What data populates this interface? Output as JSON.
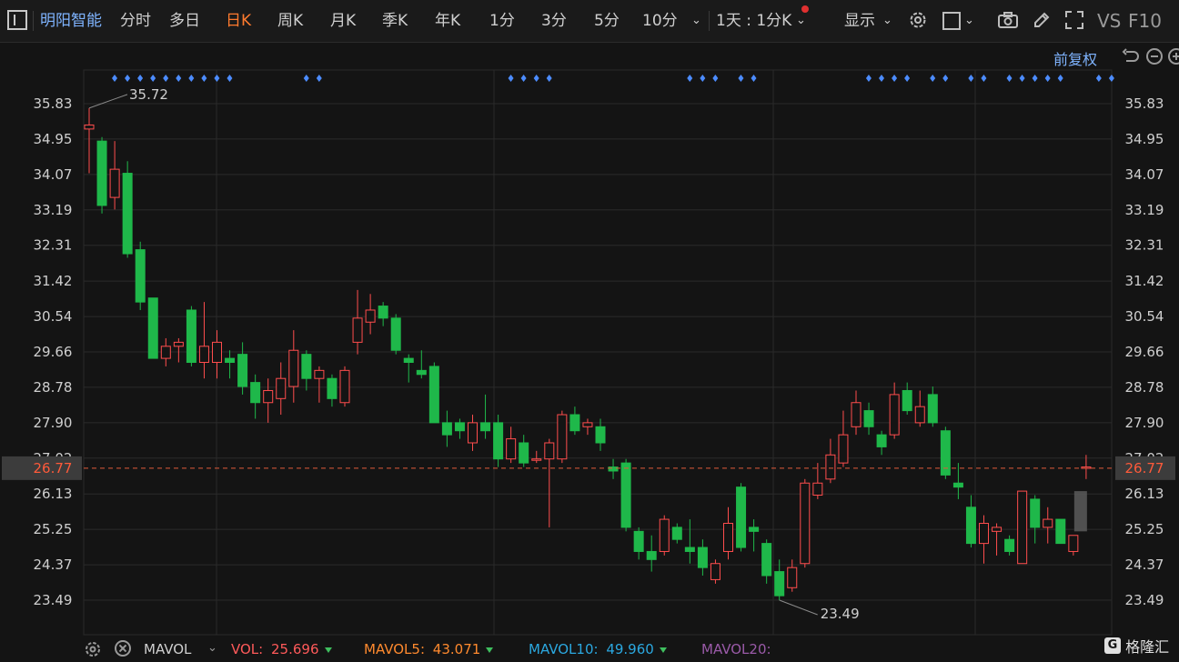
{
  "toolbar": {
    "stock_name": "明阳智能",
    "periods": [
      "分时",
      "多日",
      "日K",
      "周K",
      "月K",
      "季K",
      "年K",
      "1分",
      "3分",
      "5分",
      "10分"
    ],
    "selected_period": "日K",
    "multi_view": "1天 : 1分K",
    "display_label": "显示",
    "vs_label": "VS",
    "f10_label": "F10"
  },
  "adjust_label": "前复权",
  "colors": {
    "up": "#ff4d4d",
    "down": "#1fb84a",
    "grid": "#2a2a2a",
    "accent": "#ff7a2e",
    "blue": "#4c8cff"
  },
  "price_axis_labels": [
    "35.83",
    "34.95",
    "34.07",
    "33.19",
    "32.31",
    "31.42",
    "30.54",
    "29.66",
    "28.78",
    "27.90",
    "27.02",
    "26.13",
    "25.25",
    "24.37",
    "23.49"
  ],
  "current_price": "26.77",
  "max_annotation": "35.72",
  "min_annotation": "23.49",
  "chart_data": {
    "type": "candlestick",
    "ylim": [
      23.49,
      35.83
    ],
    "candles": [
      {
        "o": 35.2,
        "h": 35.72,
        "l": 34.1,
        "c": 35.3
      },
      {
        "o": 34.9,
        "h": 35.0,
        "l": 33.1,
        "c": 33.3
      },
      {
        "o": 33.5,
        "h": 34.9,
        "l": 33.2,
        "c": 34.2
      },
      {
        "o": 34.1,
        "h": 34.4,
        "l": 32.0,
        "c": 32.1
      },
      {
        "o": 32.2,
        "h": 32.4,
        "l": 30.7,
        "c": 30.9
      },
      {
        "o": 31.0,
        "h": 31.0,
        "l": 29.5,
        "c": 29.5
      },
      {
        "o": 29.5,
        "h": 30.0,
        "l": 29.3,
        "c": 29.8
      },
      {
        "o": 29.8,
        "h": 30.0,
        "l": 29.4,
        "c": 29.9
      },
      {
        "o": 30.7,
        "h": 30.8,
        "l": 29.3,
        "c": 29.4
      },
      {
        "o": 29.4,
        "h": 30.9,
        "l": 29.0,
        "c": 29.8
      },
      {
        "o": 29.4,
        "h": 30.2,
        "l": 29.0,
        "c": 29.9
      },
      {
        "o": 29.5,
        "h": 29.7,
        "l": 29.0,
        "c": 29.4
      },
      {
        "o": 29.6,
        "h": 29.9,
        "l": 28.6,
        "c": 28.8
      },
      {
        "o": 28.9,
        "h": 29.1,
        "l": 28.0,
        "c": 28.4
      },
      {
        "o": 28.4,
        "h": 29.0,
        "l": 27.9,
        "c": 28.7
      },
      {
        "o": 28.5,
        "h": 29.4,
        "l": 28.1,
        "c": 29.0
      },
      {
        "o": 28.8,
        "h": 30.2,
        "l": 28.4,
        "c": 29.7
      },
      {
        "o": 29.6,
        "h": 29.7,
        "l": 28.7,
        "c": 29.0
      },
      {
        "o": 29.0,
        "h": 29.3,
        "l": 28.4,
        "c": 29.2
      },
      {
        "o": 29.0,
        "h": 29.1,
        "l": 28.3,
        "c": 28.5
      },
      {
        "o": 28.4,
        "h": 29.3,
        "l": 28.3,
        "c": 29.2
      },
      {
        "o": 29.9,
        "h": 31.2,
        "l": 29.6,
        "c": 30.5
      },
      {
        "o": 30.4,
        "h": 31.1,
        "l": 30.1,
        "c": 30.7
      },
      {
        "o": 30.8,
        "h": 30.9,
        "l": 30.3,
        "c": 30.5
      },
      {
        "o": 30.5,
        "h": 30.6,
        "l": 29.6,
        "c": 29.7
      },
      {
        "o": 29.5,
        "h": 29.6,
        "l": 28.9,
        "c": 29.4
      },
      {
        "o": 29.2,
        "h": 29.7,
        "l": 29.0,
        "c": 29.1
      },
      {
        "o": 29.3,
        "h": 29.4,
        "l": 27.9,
        "c": 27.9
      },
      {
        "o": 27.9,
        "h": 28.2,
        "l": 27.3,
        "c": 27.6
      },
      {
        "o": 27.9,
        "h": 28.0,
        "l": 27.5,
        "c": 27.7
      },
      {
        "o": 27.4,
        "h": 28.1,
        "l": 27.2,
        "c": 27.9
      },
      {
        "o": 27.9,
        "h": 28.6,
        "l": 27.5,
        "c": 27.7
      },
      {
        "o": 27.9,
        "h": 28.1,
        "l": 26.8,
        "c": 27.0
      },
      {
        "o": 27.0,
        "h": 27.8,
        "l": 26.9,
        "c": 27.5
      },
      {
        "o": 27.4,
        "h": 27.6,
        "l": 26.8,
        "c": 26.9
      },
      {
        "o": 27.0,
        "h": 27.2,
        "l": 26.9,
        "c": 27.0
      },
      {
        "o": 27.0,
        "h": 27.5,
        "l": 25.3,
        "c": 27.4
      },
      {
        "o": 27.0,
        "h": 28.2,
        "l": 26.9,
        "c": 28.1
      },
      {
        "o": 28.1,
        "h": 28.3,
        "l": 27.6,
        "c": 27.7
      },
      {
        "o": 27.8,
        "h": 28.0,
        "l": 27.6,
        "c": 27.9
      },
      {
        "o": 27.8,
        "h": 28.0,
        "l": 27.2,
        "c": 27.4
      },
      {
        "o": 26.8,
        "h": 27.0,
        "l": 26.5,
        "c": 26.7
      },
      {
        "o": 26.9,
        "h": 27.0,
        "l": 25.2,
        "c": 25.3
      },
      {
        "o": 25.2,
        "h": 25.3,
        "l": 24.5,
        "c": 24.7
      },
      {
        "o": 24.7,
        "h": 25.1,
        "l": 24.2,
        "c": 24.5
      },
      {
        "o": 24.7,
        "h": 25.6,
        "l": 24.6,
        "c": 25.5
      },
      {
        "o": 25.3,
        "h": 25.4,
        "l": 24.9,
        "c": 25.0
      },
      {
        "o": 24.8,
        "h": 25.5,
        "l": 24.4,
        "c": 24.7
      },
      {
        "o": 24.8,
        "h": 25.0,
        "l": 24.1,
        "c": 24.3
      },
      {
        "o": 24.0,
        "h": 24.5,
        "l": 23.9,
        "c": 24.4
      },
      {
        "o": 24.7,
        "h": 25.8,
        "l": 24.5,
        "c": 25.4
      },
      {
        "o": 26.3,
        "h": 26.4,
        "l": 24.7,
        "c": 24.8
      },
      {
        "o": 25.3,
        "h": 25.5,
        "l": 24.7,
        "c": 25.2
      },
      {
        "o": 24.9,
        "h": 25.0,
        "l": 23.9,
        "c": 24.1
      },
      {
        "o": 24.2,
        "h": 24.5,
        "l": 23.49,
        "c": 23.6
      },
      {
        "o": 23.8,
        "h": 24.5,
        "l": 23.7,
        "c": 24.3
      },
      {
        "o": 24.4,
        "h": 26.5,
        "l": 24.3,
        "c": 26.4
      },
      {
        "o": 26.1,
        "h": 26.9,
        "l": 26.0,
        "c": 26.4
      },
      {
        "o": 26.5,
        "h": 27.5,
        "l": 26.4,
        "c": 27.1
      },
      {
        "o": 26.9,
        "h": 28.2,
        "l": 26.8,
        "c": 27.6
      },
      {
        "o": 27.8,
        "h": 28.7,
        "l": 27.6,
        "c": 28.4
      },
      {
        "o": 28.2,
        "h": 28.4,
        "l": 27.6,
        "c": 27.8
      },
      {
        "o": 27.6,
        "h": 27.7,
        "l": 27.1,
        "c": 27.3
      },
      {
        "o": 27.6,
        "h": 28.9,
        "l": 27.5,
        "c": 28.6
      },
      {
        "o": 28.7,
        "h": 28.9,
        "l": 28.1,
        "c": 28.2
      },
      {
        "o": 27.9,
        "h": 28.7,
        "l": 27.8,
        "c": 28.3
      },
      {
        "o": 28.6,
        "h": 28.8,
        "l": 27.8,
        "c": 27.9
      },
      {
        "o": 27.7,
        "h": 27.8,
        "l": 26.5,
        "c": 26.6
      },
      {
        "o": 26.4,
        "h": 26.9,
        "l": 26.0,
        "c": 26.3
      },
      {
        "o": 25.8,
        "h": 26.1,
        "l": 24.8,
        "c": 24.9
      },
      {
        "o": 24.9,
        "h": 25.6,
        "l": 24.4,
        "c": 25.4
      },
      {
        "o": 25.2,
        "h": 25.4,
        "l": 24.6,
        "c": 25.3
      },
      {
        "o": 25.0,
        "h": 25.1,
        "l": 24.6,
        "c": 24.7
      },
      {
        "o": 24.4,
        "h": 26.2,
        "l": 24.4,
        "c": 26.2
      },
      {
        "o": 26.0,
        "h": 26.1,
        "l": 24.9,
        "c": 25.3
      },
      {
        "o": 25.3,
        "h": 25.8,
        "l": 24.9,
        "c": 25.5
      },
      {
        "o": 25.5,
        "h": 25.5,
        "l": 24.9,
        "c": 24.9
      },
      {
        "o": 24.7,
        "h": 25.0,
        "l": 24.6,
        "c": 25.1
      },
      {
        "o": 26.8,
        "h": 27.1,
        "l": 26.5,
        "c": 26.8
      }
    ],
    "marker_groups": [
      [
        0,
        9
      ],
      [
        15,
        16
      ],
      [
        31,
        34
      ],
      [
        45,
        47
      ],
      [
        49,
        50
      ],
      [
        59,
        62
      ],
      [
        64,
        65
      ],
      [
        67,
        68
      ],
      [
        70,
        74
      ],
      [
        77,
        78
      ]
    ]
  },
  "volume_bar": {
    "mavol_label": "MAVOL",
    "vol_label": "VOL:",
    "vol_value": "25.696",
    "mavol5_label": "MAVOL5:",
    "mavol5_value": "43.071",
    "mavol10_label": "MAVOL10:",
    "mavol10_value": "49.960",
    "mavol20_label": "MAVOL20:",
    "mavol20_value": ""
  },
  "brand_label": "格隆汇"
}
